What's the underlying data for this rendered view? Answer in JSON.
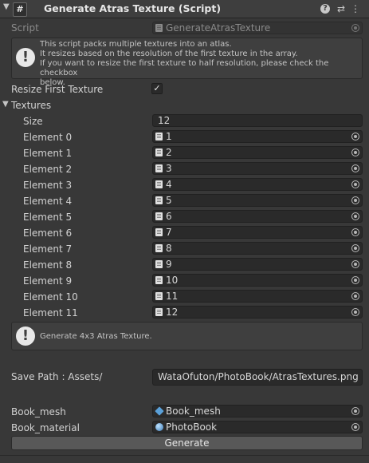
{
  "header": {
    "title": "Generate Atras Texture (Script)",
    "help_glyph": "?",
    "presets_glyph": "⇄",
    "menu_glyph": "⋮",
    "script_glyph": "#"
  },
  "script": {
    "label": "Script",
    "value": "GenerateAtrasTexture"
  },
  "info_box": {
    "lines": [
      "This script packs multiple textures into an atlas.",
      "It resizes based on the resolution of the first texture in the array.",
      "If you want to resize the first texture to half resolution, please check the checkbox",
      "below."
    ]
  },
  "resize_first": {
    "label": "Resize First Texture",
    "checked": true,
    "mark": "✓"
  },
  "textures": {
    "label": "Textures",
    "size_label": "Size",
    "size_value": "12",
    "elements": [
      {
        "label": "Element 0",
        "value": "1"
      },
      {
        "label": "Element 1",
        "value": "2"
      },
      {
        "label": "Element 2",
        "value": "3"
      },
      {
        "label": "Element 3",
        "value": "4"
      },
      {
        "label": "Element 4",
        "value": "5"
      },
      {
        "label": "Element 5",
        "value": "6"
      },
      {
        "label": "Element 6",
        "value": "7"
      },
      {
        "label": "Element 7",
        "value": "8"
      },
      {
        "label": "Element 8",
        "value": "9"
      },
      {
        "label": "Element 9",
        "value": "10"
      },
      {
        "label": "Element 10",
        "value": "11"
      },
      {
        "label": "Element 11",
        "value": "12"
      }
    ]
  },
  "generate_info": {
    "text": "Generate 4x3 Atras Texture."
  },
  "save_path": {
    "label": "Save Path : Assets/",
    "value": "WataOfuton/PhotoBook/AtrasTextures.png"
  },
  "book_mesh": {
    "label": "Book_mesh",
    "value": "Book_mesh"
  },
  "book_material": {
    "label": "Book_material",
    "value": "PhotoBook"
  },
  "generate_button": {
    "label": "Generate"
  }
}
